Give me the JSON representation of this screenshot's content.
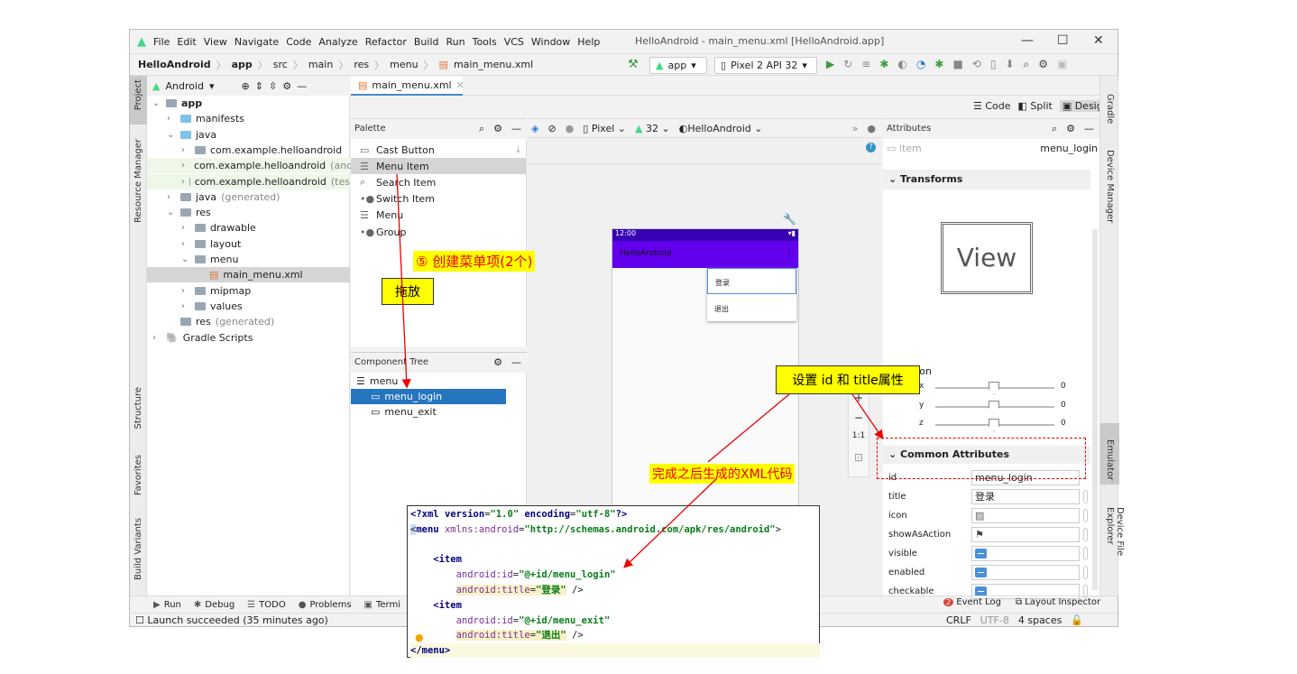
{
  "menubar": [
    "File",
    "Edit",
    "View",
    "Navigate",
    "Code",
    "Analyze",
    "Refactor",
    "Build",
    "Run",
    "Tools",
    "VCS",
    "Window",
    "Help"
  ],
  "window_title": "HelloAndroid - main_menu.xml [HelloAndroid.app]",
  "breadcrumb": [
    "HelloAndroid",
    "app",
    "src",
    "main",
    "res",
    "menu",
    "main_menu.xml"
  ],
  "toolbar": {
    "run_config": "app",
    "device": "Pixel 2 API 32"
  },
  "left_strip": [
    "Project",
    "Resource Manager",
    "Structure",
    "Favorites",
    "Build Variants"
  ],
  "right_strip": [
    "Gradle",
    "Device Manager",
    "Emulator",
    "Device File Explorer"
  ],
  "project": {
    "view": "Android",
    "tree": [
      {
        "label": "app",
        "level": 0,
        "open": true,
        "bold": true
      },
      {
        "label": "manifests",
        "level": 1,
        "open": false,
        "blue": true
      },
      {
        "label": "java",
        "level": 1,
        "open": true,
        "blue": true
      },
      {
        "label": "com.example.helloandroid",
        "level": 2,
        "open": false
      },
      {
        "label": "com.example.helloandroid",
        "suffix": "(andr",
        "level": 2,
        "open": false,
        "green": true
      },
      {
        "label": "com.example.helloandroid",
        "suffix": "(tes",
        "level": 2,
        "open": false,
        "green": true
      },
      {
        "label": "java",
        "suffix": "(generated)",
        "level": 1,
        "open": false
      },
      {
        "label": "res",
        "level": 1,
        "open": true
      },
      {
        "label": "drawable",
        "level": 2,
        "open": false
      },
      {
        "label": "layout",
        "level": 2,
        "open": false
      },
      {
        "label": "menu",
        "level": 2,
        "open": true
      },
      {
        "label": "main_menu.xml",
        "level": 3,
        "file": true,
        "selected": true
      },
      {
        "label": "mipmap",
        "level": 2,
        "open": false
      },
      {
        "label": "values",
        "level": 2,
        "open": false
      },
      {
        "label": "res",
        "suffix": "(generated)",
        "level": 1,
        "leaf": true
      },
      {
        "label": "Gradle Scripts",
        "level": 0,
        "open": false
      }
    ]
  },
  "editor_tab": "main_menu.xml",
  "view_modes": {
    "code": "Code",
    "split": "Split",
    "design": "Design"
  },
  "palette": {
    "title": "Palette",
    "items": [
      "Cast Button",
      "Menu Item",
      "Search Item",
      "Switch Item",
      "Menu",
      "Group"
    ],
    "selected": 1
  },
  "component_tree": {
    "title": "Component Tree",
    "root": "menu",
    "items": [
      "menu_login",
      "menu_exit"
    ],
    "selected": 0
  },
  "design_toolbar": {
    "device": "Pixel",
    "api": "32",
    "theme": "HelloAndroid"
  },
  "preview": {
    "time": "12:00",
    "app_title": "HelloAndroid",
    "menu_items": [
      "登录",
      "退出"
    ]
  },
  "attributes": {
    "title": "Attributes",
    "type": "item",
    "id_value": "menu_login",
    "transforms": "Transforms",
    "view_label": "View",
    "rotation": "Rotation",
    "rot": [
      {
        "axis": "x",
        "value": "0"
      },
      {
        "axis": "y",
        "value": "0"
      },
      {
        "axis": "z",
        "value": "0"
      }
    ],
    "common": "Common Attributes",
    "rows": [
      {
        "name": "id",
        "value": "menu_login"
      },
      {
        "name": "title",
        "value": "登录"
      },
      {
        "name": "icon",
        "value": ""
      },
      {
        "name": "showAsAction",
        "value": ""
      },
      {
        "name": "visible",
        "value": ""
      },
      {
        "name": "enabled",
        "value": ""
      },
      {
        "name": "checkable",
        "value": ""
      }
    ]
  },
  "bottom_tabs": [
    "Run",
    "Debug",
    "TODO",
    "Problems",
    "Termi"
  ],
  "bottom_right": {
    "event_log": "Event Log",
    "event_count": "2",
    "layout_inspector": "Layout Inspector"
  },
  "status": {
    "message": "Launch succeeded (35 minutes ago)",
    "line_sep": "CRLF",
    "encoding": "UTF-8",
    "indent": "4 spaces"
  },
  "zoom_controls": [
    "+",
    "−",
    "1:1"
  ],
  "annotations": {
    "create": "⑤ 创建菜单项(2个)",
    "drag": "拖放",
    "set_attrs": "设置 id 和 title属性",
    "xml_done": "完成之后生成的XML代码"
  },
  "code": {
    "lines": [
      "<?xml version=\"1.0\" encoding=\"utf-8\"?>",
      "<menu xmlns:android=\"http://schemas.android.com/apk/res/android\">",
      "",
      "    <item",
      "        android:id=\"@+id/menu_login\"",
      "        android:title=\"登录\" />",
      "    <item",
      "        android:id=\"@+id/menu_exit\"",
      "        android:title=\"退出\" />",
      "</menu>"
    ]
  }
}
